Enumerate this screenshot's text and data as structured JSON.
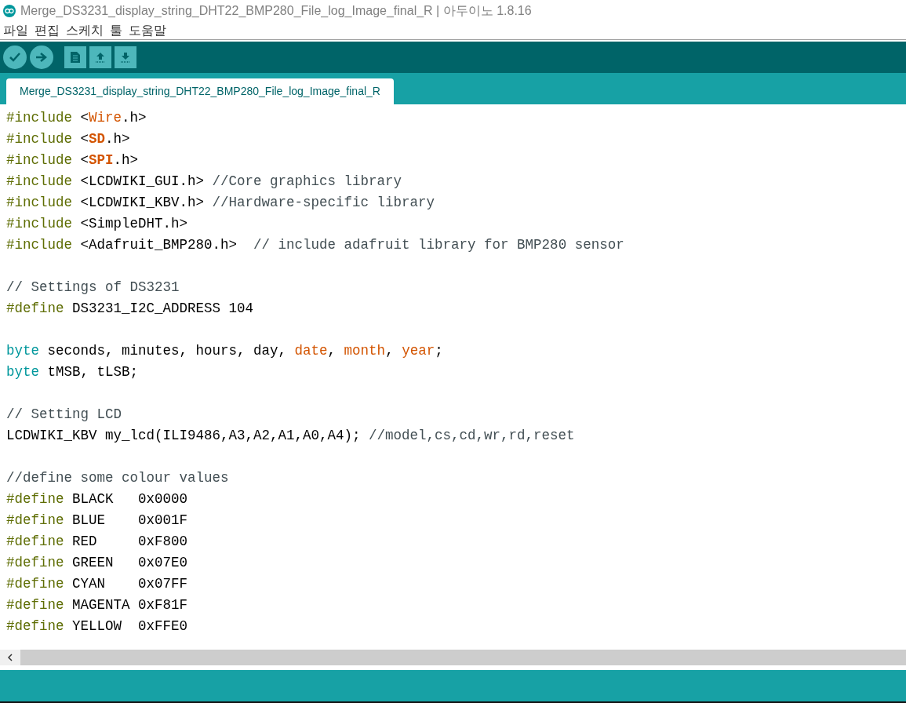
{
  "window": {
    "title": "Merge_DS3231_display_string_DHT22_BMP280_File_log_Image_final_R | 아두이노 1.8.16"
  },
  "menu": [
    "파일",
    "편집",
    "스케치",
    "툴",
    "도움말"
  ],
  "toolbar": [
    {
      "kind": "verify"
    },
    {
      "kind": "upload"
    },
    {
      "kind": "new"
    },
    {
      "kind": "open"
    },
    {
      "kind": "save"
    }
  ],
  "tabs": [
    {
      "label": "Merge_DS3231_display_string_DHT22_BMP280_File_log_Image_final_R",
      "selected": true
    }
  ],
  "editor": {
    "lines": [
      {
        "kind": "code",
        "tokens": [
          {
            "text": "#include",
            "kind": "pre"
          },
          {
            "text": " <",
            "kind": "plain"
          },
          {
            "text": "Wire",
            "kind": "lib"
          },
          {
            "text": ".h>",
            "kind": "plain"
          }
        ]
      },
      {
        "kind": "code",
        "tokens": [
          {
            "text": "#include",
            "kind": "pre"
          },
          {
            "text": " <",
            "kind": "plain"
          },
          {
            "text": "SD",
            "kind": "libbold"
          },
          {
            "text": ".h>",
            "kind": "plain"
          }
        ]
      },
      {
        "kind": "code",
        "tokens": [
          {
            "text": "#include",
            "kind": "pre"
          },
          {
            "text": " <",
            "kind": "plain"
          },
          {
            "text": "SPI",
            "kind": "libbold"
          },
          {
            "text": ".h>",
            "kind": "plain"
          }
        ]
      },
      {
        "kind": "code",
        "tokens": [
          {
            "text": "#include",
            "kind": "pre"
          },
          {
            "text": " <LCDWIKI_GUI.h> ",
            "kind": "plain"
          },
          {
            "text": "//Core graphics library",
            "kind": "comment"
          }
        ]
      },
      {
        "kind": "code",
        "tokens": [
          {
            "text": "#include",
            "kind": "pre"
          },
          {
            "text": " <LCDWIKI_KBV.h> ",
            "kind": "plain"
          },
          {
            "text": "//Hardware-specific library",
            "kind": "comment"
          }
        ]
      },
      {
        "kind": "code",
        "tokens": [
          {
            "text": "#include",
            "kind": "pre"
          },
          {
            "text": " <SimpleDHT.h>",
            "kind": "plain"
          }
        ]
      },
      {
        "kind": "code",
        "tokens": [
          {
            "text": "#include",
            "kind": "pre"
          },
          {
            "text": " <Adafruit_BMP280.h>  ",
            "kind": "plain"
          },
          {
            "text": "// include adafruit library for BMP280 sensor",
            "kind": "comment"
          }
        ]
      },
      {
        "kind": "blank"
      },
      {
        "kind": "code",
        "tokens": [
          {
            "text": "// Settings of DS3231",
            "kind": "comment"
          }
        ]
      },
      {
        "kind": "code",
        "tokens": [
          {
            "text": "#define",
            "kind": "pre"
          },
          {
            "text": " DS3231_I2C_ADDRESS 104",
            "kind": "plain"
          }
        ]
      },
      {
        "kind": "blank"
      },
      {
        "kind": "code",
        "tokens": [
          {
            "text": "byte",
            "kind": "type"
          },
          {
            "text": " seconds, minutes, hours, day, ",
            "kind": "plain"
          },
          {
            "text": "date",
            "kind": "lib"
          },
          {
            "text": ", ",
            "kind": "plain"
          },
          {
            "text": "month",
            "kind": "lib"
          },
          {
            "text": ", ",
            "kind": "plain"
          },
          {
            "text": "year",
            "kind": "lib"
          },
          {
            "text": ";",
            "kind": "plain"
          }
        ]
      },
      {
        "kind": "code",
        "tokens": [
          {
            "text": "byte",
            "kind": "type"
          },
          {
            "text": " tMSB, tLSB;",
            "kind": "plain"
          }
        ]
      },
      {
        "kind": "blank"
      },
      {
        "kind": "code",
        "tokens": [
          {
            "text": "// Setting LCD",
            "kind": "comment"
          }
        ]
      },
      {
        "kind": "code",
        "tokens": [
          {
            "text": "LCDWIKI_KBV my_lcd(ILI9486,A3,A2,A1,A0,A4); ",
            "kind": "plain"
          },
          {
            "text": "//model,cs,cd,wr,rd,reset",
            "kind": "comment"
          }
        ]
      },
      {
        "kind": "blank"
      },
      {
        "kind": "code",
        "tokens": [
          {
            "text": "//define some colour values",
            "kind": "comment"
          }
        ]
      },
      {
        "kind": "code",
        "tokens": [
          {
            "text": "#define",
            "kind": "pre"
          },
          {
            "text": " BLACK   0x0000",
            "kind": "plain"
          }
        ]
      },
      {
        "kind": "code",
        "tokens": [
          {
            "text": "#define",
            "kind": "pre"
          },
          {
            "text": " BLUE    0x001F",
            "kind": "plain"
          }
        ]
      },
      {
        "kind": "code",
        "tokens": [
          {
            "text": "#define",
            "kind": "pre"
          },
          {
            "text": " RED     0xF800",
            "kind": "plain"
          }
        ]
      },
      {
        "kind": "code",
        "tokens": [
          {
            "text": "#define",
            "kind": "pre"
          },
          {
            "text": " GREEN   0x07E0",
            "kind": "plain"
          }
        ]
      },
      {
        "kind": "code",
        "tokens": [
          {
            "text": "#define",
            "kind": "pre"
          },
          {
            "text": " CYAN    0x07FF",
            "kind": "plain"
          }
        ]
      },
      {
        "kind": "code",
        "tokens": [
          {
            "text": "#define",
            "kind": "pre"
          },
          {
            "text": " MAGENTA 0xF81F",
            "kind": "plain"
          }
        ]
      },
      {
        "kind": "code",
        "tokens": [
          {
            "text": "#define",
            "kind": "pre"
          },
          {
            "text": " YELLOW  0xFFE0",
            "kind": "plain"
          }
        ]
      }
    ]
  }
}
